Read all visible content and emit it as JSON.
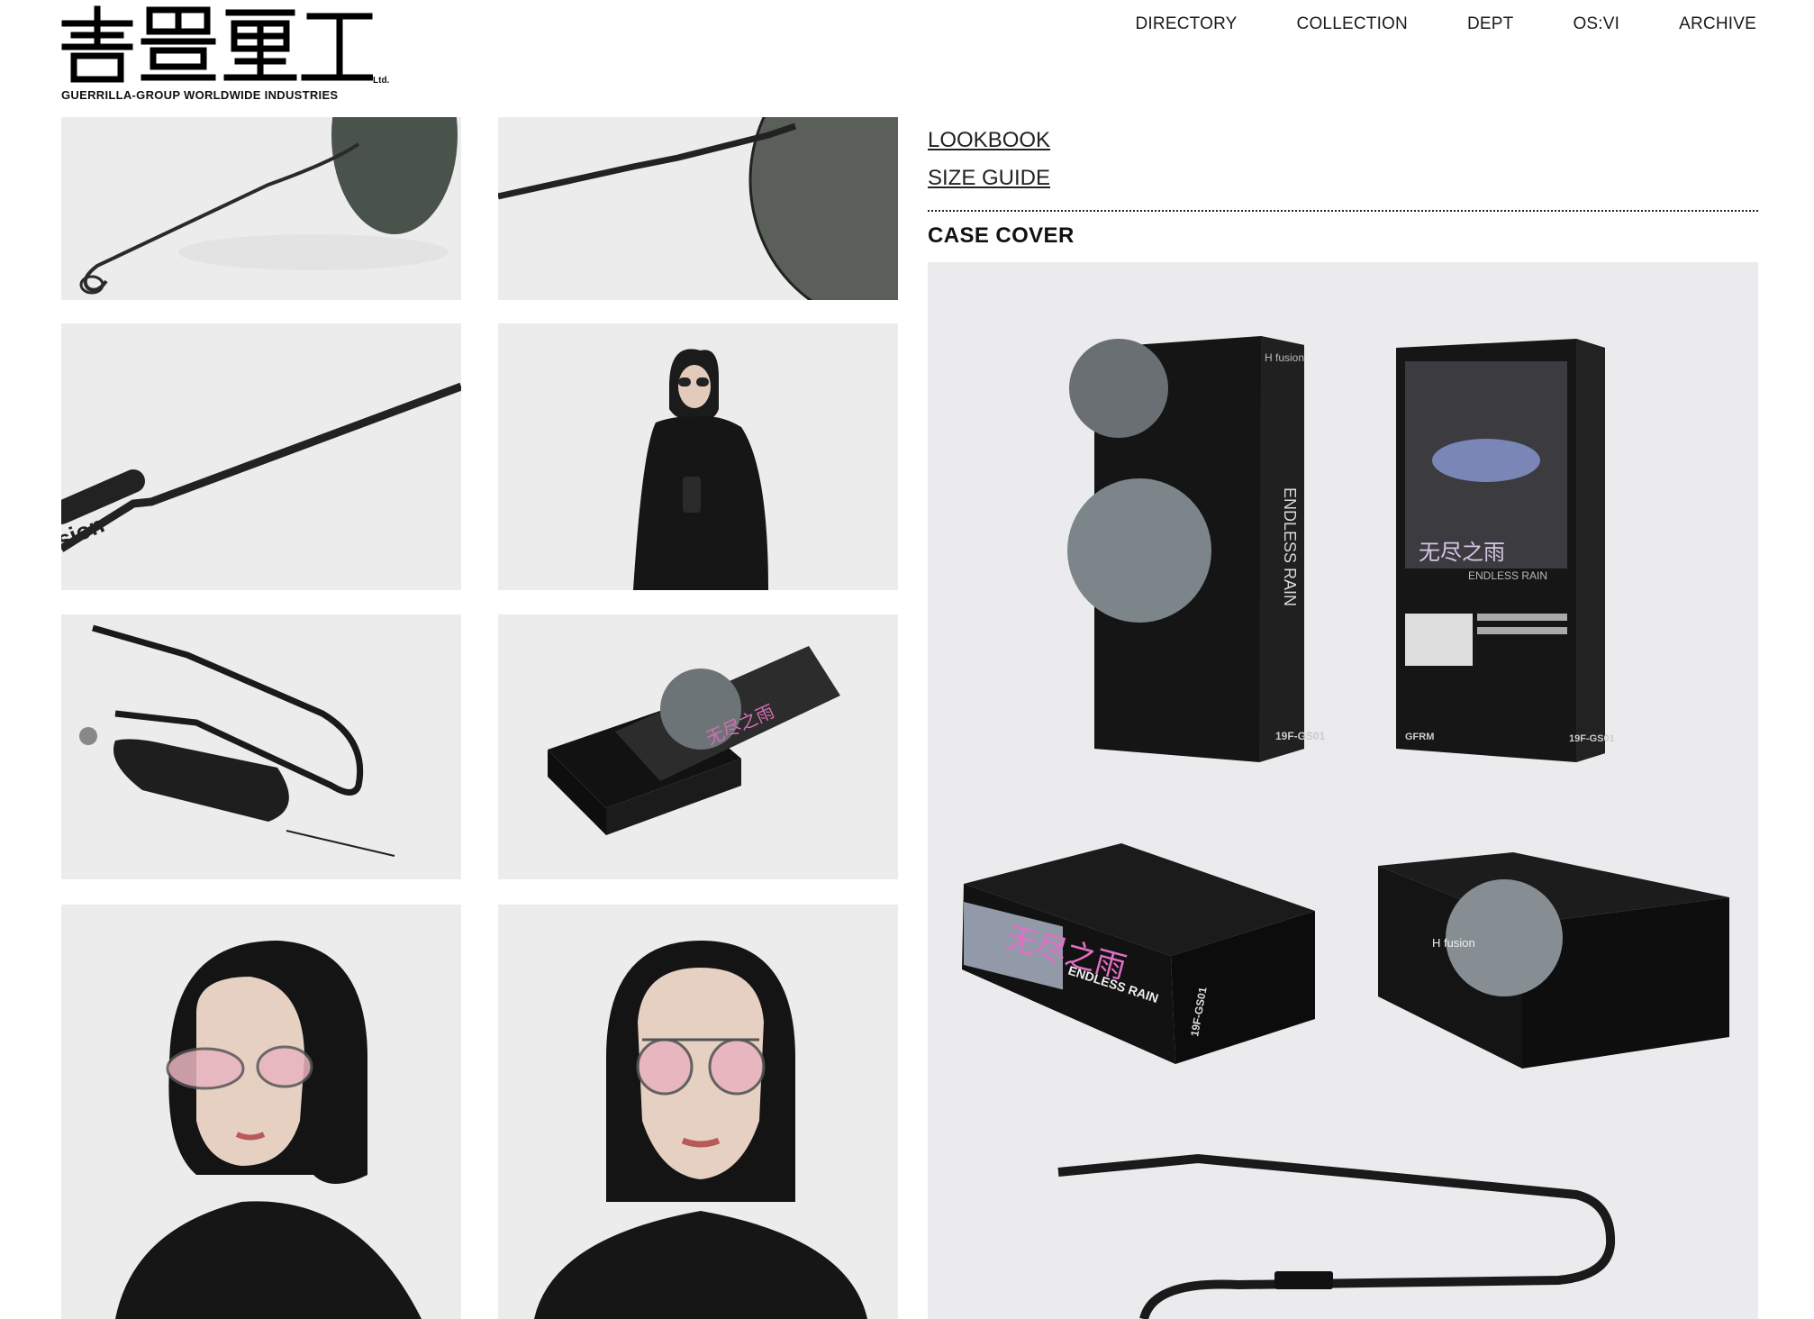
{
  "brand": {
    "logo_glyphs": "吉豈重工",
    "logo_ltd": "Ltd.",
    "logo_subtitle": "GUERRILLA-GROUP WORLDWIDE INDUSTRIES"
  },
  "nav": {
    "items": [
      "DIRECTORY",
      "COLLECTION",
      "DEPT",
      "OS:VI",
      "ARCHIVE"
    ]
  },
  "product_links": {
    "lookbook": "LOOKBOOK",
    "size_guide": "SIZE GUIDE"
  },
  "section": {
    "title": "CASE COVER"
  },
  "case_cover": {
    "box_texts": {
      "brand_small": "H fusion",
      "title_cn": "无尽之雨",
      "title_en": "ENDLESS RAIN",
      "code": "19F-GS01",
      "mark": "GFRM"
    }
  },
  "gallery": {
    "tiles": [
      "temple-arm-closeup-left",
      "temple-arm-closeup-right",
      "temple-detail",
      "model-full-body",
      "strap-and-pouch",
      "box-open",
      "model-portrait-side",
      "model-portrait-front"
    ]
  }
}
